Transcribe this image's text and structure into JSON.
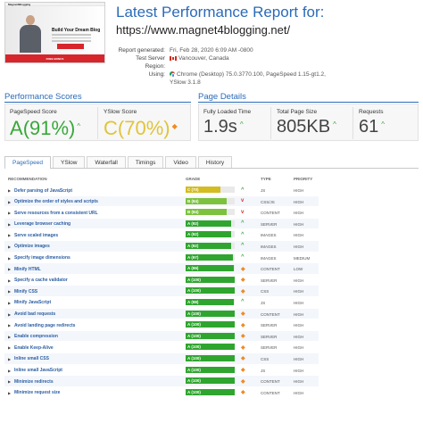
{
  "thumbnail": {
    "site_logo": "Magnet4Blogging",
    "headline": "Build Your Dream Blog",
    "footer_text": "FREE BONUS"
  },
  "report": {
    "title": "Latest Performance Report for:",
    "url": "https://www.magnet4blogging.net/",
    "meta": [
      {
        "key": "Report generated:",
        "value": "Fri, Feb 28, 2020 6:09 AM -0800",
        "icon": ""
      },
      {
        "key": "Test Server Region:",
        "value": "Vancouver, Canada",
        "icon": "canada-flag-icon"
      },
      {
        "key": "Using:",
        "value": "Chrome (Desktop) 75.0.3770.100, PageSpeed 1.15-gt1.2,",
        "icon": "chrome-icon"
      },
      {
        "key": "",
        "value": "YSlow 3.1.8",
        "icon": ""
      }
    ]
  },
  "performance_scores": {
    "title": "Performance Scores",
    "pagespeed": {
      "label": "PageSpeed Score",
      "grade": "A",
      "percent": "(91%)",
      "trend": "^",
      "color": "#38a83a"
    },
    "yslow": {
      "label": "YSlow Score",
      "grade": "C",
      "percent": "(70%)",
      "trend": "◆",
      "color": "#e0c43a",
      "trend_color": "#f08a24"
    }
  },
  "page_details": {
    "title": "Page Details",
    "items": [
      {
        "label": "Fully Loaded Time",
        "value": "1.9s",
        "trend": "^"
      },
      {
        "label": "Total Page Size",
        "value": "805KB",
        "trend": "^"
      },
      {
        "label": "Requests",
        "value": "61",
        "trend": "^"
      }
    ]
  },
  "tabs": [
    "PageSpeed",
    "YSlow",
    "Waterfall",
    "Timings",
    "Video",
    "History"
  ],
  "table": {
    "headers": {
      "recommendation": "RECOMMENDATION",
      "grade": "GRADE",
      "type": "TYPE",
      "priority": "PRIORITY"
    },
    "rows": [
      {
        "rec": "Defer parsing of JavaScript",
        "grade": "C (70)",
        "score": 70,
        "color": "#d2bc22",
        "ind": "up",
        "type": "JS",
        "prio": "HIGH"
      },
      {
        "rec": "Optimize the order of styles and scripts",
        "grade": "B (84)",
        "score": 84,
        "color": "#7cc23f",
        "ind": "down",
        "type": "CSS/JS",
        "prio": "HIGH"
      },
      {
        "rec": "Serve resources from a consistent URL",
        "grade": "B (84)",
        "score": 84,
        "color": "#7cc23f",
        "ind": "down",
        "type": "CONTENT",
        "prio": "HIGH"
      },
      {
        "rec": "Leverage browser caching",
        "grade": "A (92)",
        "score": 92,
        "color": "#2fa52f",
        "ind": "up",
        "type": "SERVER",
        "prio": "HIGH"
      },
      {
        "rec": "Serve scaled images",
        "grade": "A (92)",
        "score": 92,
        "color": "#2fa52f",
        "ind": "up",
        "type": "IMAGES",
        "prio": "HIGH"
      },
      {
        "rec": "Optimize images",
        "grade": "A (92)",
        "score": 92,
        "color": "#2fa52f",
        "ind": "up",
        "type": "IMAGES",
        "prio": "HIGH"
      },
      {
        "rec": "Specify image dimensions",
        "grade": "A (97)",
        "score": 97,
        "color": "#2fa52f",
        "ind": "up",
        "type": "IMAGES",
        "prio": "MEDIUM"
      },
      {
        "rec": "Minify HTML",
        "grade": "A (99)",
        "score": 99,
        "color": "#2fa52f",
        "ind": "diamond",
        "type": "CONTENT",
        "prio": "LOW"
      },
      {
        "rec": "Specify a cache validator",
        "grade": "A (100)",
        "score": 100,
        "color": "#2fa52f",
        "ind": "diamond",
        "type": "SERVER",
        "prio": "HIGH"
      },
      {
        "rec": "Minify CSS",
        "grade": "A (100)",
        "score": 100,
        "color": "#2fa52f",
        "ind": "diamond",
        "type": "CSS",
        "prio": "HIGH"
      },
      {
        "rec": "Minify JavaScript",
        "grade": "A (98)",
        "score": 98,
        "color": "#2fa52f",
        "ind": "up",
        "type": "JS",
        "prio": "HIGH"
      },
      {
        "rec": "Avoid bad requests",
        "grade": "A (100)",
        "score": 100,
        "color": "#2fa52f",
        "ind": "diamond",
        "type": "CONTENT",
        "prio": "HIGH"
      },
      {
        "rec": "Avoid landing page redirects",
        "grade": "A (100)",
        "score": 100,
        "color": "#2fa52f",
        "ind": "diamond",
        "type": "SERVER",
        "prio": "HIGH"
      },
      {
        "rec": "Enable compression",
        "grade": "A (100)",
        "score": 100,
        "color": "#2fa52f",
        "ind": "diamond",
        "type": "SERVER",
        "prio": "HIGH"
      },
      {
        "rec": "Enable Keep-Alive",
        "grade": "A (100)",
        "score": 100,
        "color": "#2fa52f",
        "ind": "diamond",
        "type": "SERVER",
        "prio": "HIGH"
      },
      {
        "rec": "Inline small CSS",
        "grade": "A (100)",
        "score": 100,
        "color": "#2fa52f",
        "ind": "diamond",
        "type": "CSS",
        "prio": "HIGH"
      },
      {
        "rec": "Inline small JavaScript",
        "grade": "A (100)",
        "score": 100,
        "color": "#2fa52f",
        "ind": "diamond",
        "type": "JS",
        "prio": "HIGH"
      },
      {
        "rec": "Minimize redirects",
        "grade": "A (100)",
        "score": 100,
        "color": "#2fa52f",
        "ind": "diamond",
        "type": "CONTENT",
        "prio": "HIGH"
      },
      {
        "rec": "Minimize request size",
        "grade": "A (100)",
        "score": 100,
        "color": "#2fa52f",
        "ind": "diamond",
        "type": "CONTENT",
        "prio": "HIGH"
      }
    ]
  },
  "colors": {
    "accent_blue": "#2b6bb8",
    "grade_a": "#38a83a",
    "grade_c": "#e0c43a",
    "up_arrow": "#38a83a",
    "down_arrow": "#d9342b",
    "diamond": "#f08a24"
  }
}
